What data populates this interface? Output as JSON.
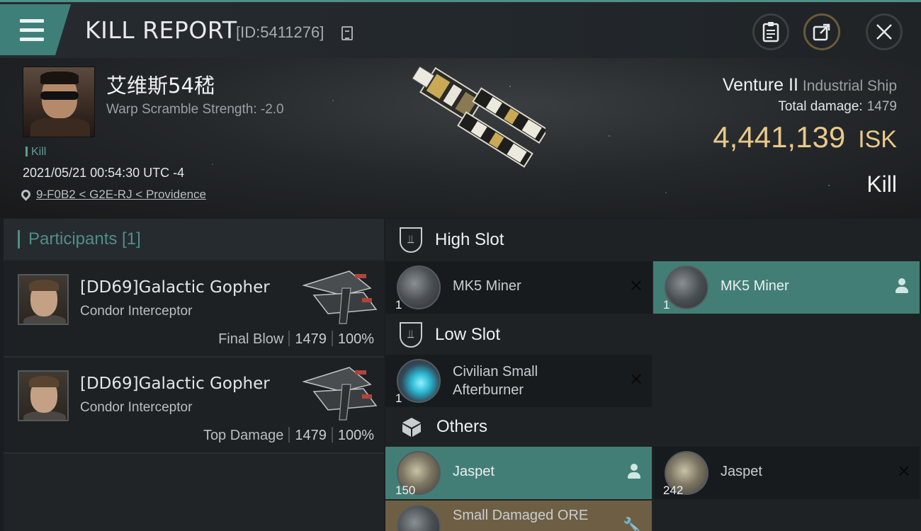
{
  "header": {
    "title": "KILL REPORT",
    "report_id": "[ID:5411276]"
  },
  "victim": {
    "name": "艾维斯54嵇",
    "warp_scramble": "Warp Scramble Strength: -2.0",
    "tag": "Kill",
    "datetime": "2021/05/21 00:54:30 UTC -4",
    "location": "9-F0B2 < G2E-RJ < Providence",
    "ship_name": "Venture II",
    "ship_class": "Industrial Ship",
    "total_damage_label": "Total damage:",
    "total_damage": "1479",
    "isk_value": "4,441,139",
    "isk_unit": "ISK",
    "result": "Kill"
  },
  "participants": {
    "label": "Participants [1]",
    "rows": [
      {
        "name": "[DD69]Galactic Gopher",
        "ship": "Condor Interceptor",
        "role": "Final Blow",
        "damage": "1479",
        "percent": "100%"
      },
      {
        "name": "[DD69]Galactic Gopher",
        "ship": "Condor Interceptor",
        "role": "Top Damage",
        "damage": "1479",
        "percent": "100%"
      }
    ]
  },
  "fitting": {
    "high_slot": {
      "label": "High Slot",
      "items": [
        {
          "name": "MK5 Miner",
          "qty": "1",
          "status": "destroyed"
        },
        {
          "name": "MK5 Miner",
          "qty": "1",
          "status": "dropped"
        }
      ]
    },
    "low_slot": {
      "label": "Low Slot",
      "items": [
        {
          "name_line1": "Civilian Small",
          "name_line2": "Afterburner",
          "qty": "1",
          "status": "destroyed"
        }
      ]
    },
    "others": {
      "label": "Others",
      "items": [
        {
          "name": "Jaspet",
          "qty": "150",
          "status": "dropped"
        },
        {
          "name": "Jaspet",
          "qty": "242",
          "status": "destroyed"
        },
        {
          "name": "Small Damaged ORE",
          "qty": "",
          "status": "cargo"
        }
      ]
    }
  },
  "colors": {
    "accent": "#437e76",
    "isk": "#e8c98a",
    "background": "#1a1d21"
  },
  "icons": {
    "menu": "hamburger-icon",
    "copy": "copy-icon",
    "clipboard": "clipboard-icon",
    "share": "share-icon",
    "close": "close-icon",
    "location": "location-pin-icon",
    "slot": "slot-shield-icon",
    "cargo": "cube-icon",
    "destroyed": "x-icon",
    "dropped": "person-icon"
  }
}
